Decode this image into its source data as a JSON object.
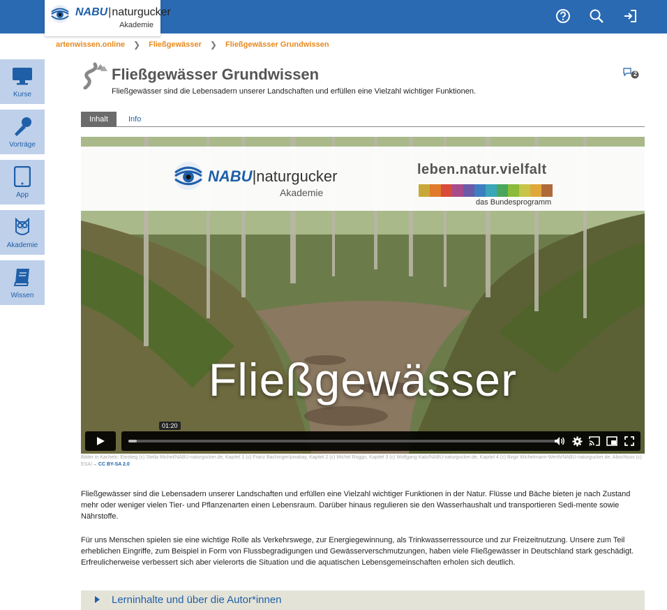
{
  "header": {
    "logo_brand": "NABU",
    "logo_sep": "|",
    "logo_name": "naturgucker",
    "logo_sub": "Akademie",
    "icons": [
      "help-icon",
      "search-icon",
      "logout-icon"
    ]
  },
  "breadcrumb": {
    "items": [
      "artenwissen.online",
      "Fließgewässer",
      "Fließgewässer Grundwissen"
    ]
  },
  "sidebar": {
    "items": [
      {
        "label": "Kurse",
        "icon": "monitor-icon"
      },
      {
        "label": "Vorträge",
        "icon": "microphone-icon"
      },
      {
        "label": "App",
        "icon": "tablet-icon"
      },
      {
        "label": "Akademie",
        "icon": "owl-icon"
      },
      {
        "label": "Wissen",
        "icon": "book-icon"
      }
    ]
  },
  "page": {
    "title": "Fließgewässer Grundwissen",
    "subtitle": "Fließgewässer sind die Lebensadern unserer Landschaften und erfüllen eine Vielzahl wichtiger Funktionen.",
    "comment_count": "2"
  },
  "tabs": [
    "Inhalt",
    "Info"
  ],
  "video": {
    "banner_brand": "NABU",
    "banner_name": "naturgucker",
    "banner_sub": "Akademie",
    "partner_name": "leben.natur.vielfalt",
    "partner_sub": "das Bundesprogramm",
    "overlay_title": "Fließgewässer",
    "current_time": "01:20",
    "progress_fraction": 0.02
  },
  "credits": {
    "text": "Bilder in Kacheln: Einstieg (c) Stella Michel/NABU-naturgucker.de, Kapitel 1 (c) Franz Bachinger/pixabay, Kapitel 2 (c) Michel Roggo, Kapitel 3 (c) Wolfgang Katz/NABU-naturgucker.de, Kapitel 4 (c) Birgit Wichelmann-Werth/NABU-naturgucker.de, Abschluss (c) ESA/",
    "license": "→ CC BY-SA 2.0"
  },
  "content": {
    "paragraph1": "Fließgewässer sind die Lebensadern unserer Landschaften und erfüllen eine Vielzahl wichtiger Funktionen in der Natur. Flüsse und Bäche bieten je nach Zustand mehr oder weniger vielen Tier- und Pflanzenarten einen Lebensraum. Darüber hinaus regulieren sie den Wasserhaushalt und transportieren Sedi-mente sowie Nährstoffe.",
    "paragraph2": "Für uns Menschen spielen sie eine wichtige Rolle als Verkehrswege, zur Energiegewinnung, als Trinkwasserressource und zur Freizeitnutzung. Unsere zum Teil erheblichen Eingriffe, zum Beispiel in Form von Flussbegradigungen und Gewässerverschmutzungen, haben viele Fließgewässer in Deutschland stark geschädigt. Erfreulicherweise verbessert sich aber vielerorts die Situation und die aquatischen Lebensgemeinschaften erholen sich deutlich."
  },
  "accordion": {
    "label": "Lerninhalte und über die Autor*innen"
  },
  "colors": {
    "topbar": "#2a6ab3",
    "accent": "#1f5fa8",
    "breadcrumb": "#e8891e",
    "sidebar_bg": "#bfd0ea",
    "tab_active": "#6b6b6b",
    "accordion_bg": "#e4e3d8"
  }
}
